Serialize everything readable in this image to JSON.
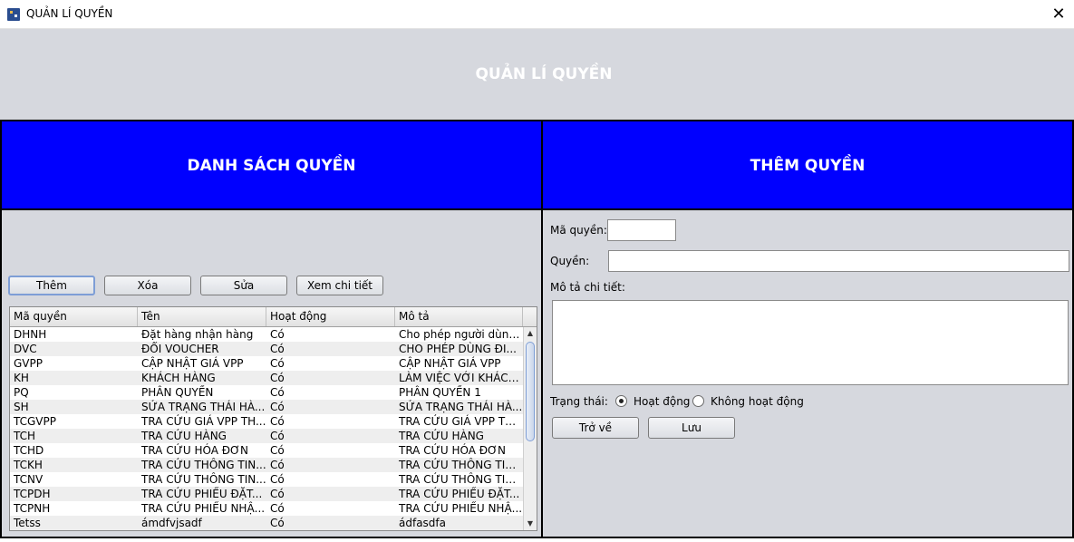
{
  "window": {
    "title": "QUẢN LÍ QUYỀN",
    "close_glyph": "✕"
  },
  "header": {
    "title": "QUẢN LÍ QUYỀN"
  },
  "left_panel": {
    "title": "DANH SÁCH QUYỀN",
    "buttons": {
      "add": "Thêm",
      "delete": "Xóa",
      "edit": "Sửa",
      "details": "Xem chi tiết"
    },
    "table": {
      "columns": [
        "Mã quyền",
        "Tên",
        "Hoạt động",
        "Mô tả"
      ],
      "rows": [
        [
          "DHNH",
          "Đặt hàng nhận hàng",
          "Có",
          "Cho phép người dùng..."
        ],
        [
          "DVC",
          "ĐỔI VOUCHER",
          "Có",
          "CHO PHÉP DÙNG ĐI..."
        ],
        [
          "GVPP",
          "CẬP NHẬT GIÁ VPP",
          "Có",
          "CẬP NHẬT GIÁ VPP"
        ],
        [
          "KH",
          "KHÁCH HÀNG",
          "Có",
          "LÀM VIỆC VỚI KHÁCH..."
        ],
        [
          "PQ",
          "PHÂN QUYỀN",
          "Có",
          "PHÂN QUYỀN 1"
        ],
        [
          "SH",
          "SỬA TRẠNG THÁI HÀ...",
          "Có",
          "SỬA TRẠNG THÁI HÀ..."
        ],
        [
          "TCGVPP",
          "TRA CỨU GIÁ VPP TH...",
          "Có",
          "TRA CỨU GIÁ VPP TH..."
        ],
        [
          "TCH",
          "TRA CỨU HÀNG",
          "Có",
          "TRA CỨU HÀNG"
        ],
        [
          "TCHD",
          "TRA CỨU HÓA ĐƠN",
          "Có",
          "TRA CỨU HÓA ĐƠN"
        ],
        [
          "TCKH",
          "TRA CỨU THÔNG TIN...",
          "Có",
          "TRA CỨU THÔNG TIN..."
        ],
        [
          "TCNV",
          "TRA CỨU THÔNG TIN...",
          "Có",
          "TRA CỨU THÔNG TIN..."
        ],
        [
          "TCPDH",
          "TRA CỨU PHIẾU ĐẶT...",
          "Có",
          "TRA CỨU PHIẾU ĐẶT..."
        ],
        [
          "TCPNH",
          "TRA CỨU PHIẾU NHẬ...",
          "Có",
          "TRA CỨU PHIẾU NHẬ..."
        ],
        [
          "Tetss",
          "ámdfvjsadf",
          "Có",
          "ádfasdfa"
        ]
      ]
    },
    "scrollbar": {
      "up_glyph": "▲",
      "down_glyph": "▼"
    }
  },
  "right_panel": {
    "title": "THÊM QUYỀN",
    "form": {
      "code_label": "Mã quyền:",
      "code_value": "",
      "name_label": "Quyền:",
      "name_value": "",
      "desc_label": "Mô tả chi tiết:",
      "desc_value": "",
      "status_label": "Trạng thái:",
      "status_active": "Hoạt động",
      "status_inactive": "Không hoạt động",
      "selected_status": "Hoạt động"
    },
    "buttons": {
      "back": "Trở về",
      "save": "Lưu"
    }
  },
  "colors": {
    "panel_header_bg": "#0000ff",
    "panel_bg": "#d6d8de",
    "header_text": "#ffffff"
  }
}
